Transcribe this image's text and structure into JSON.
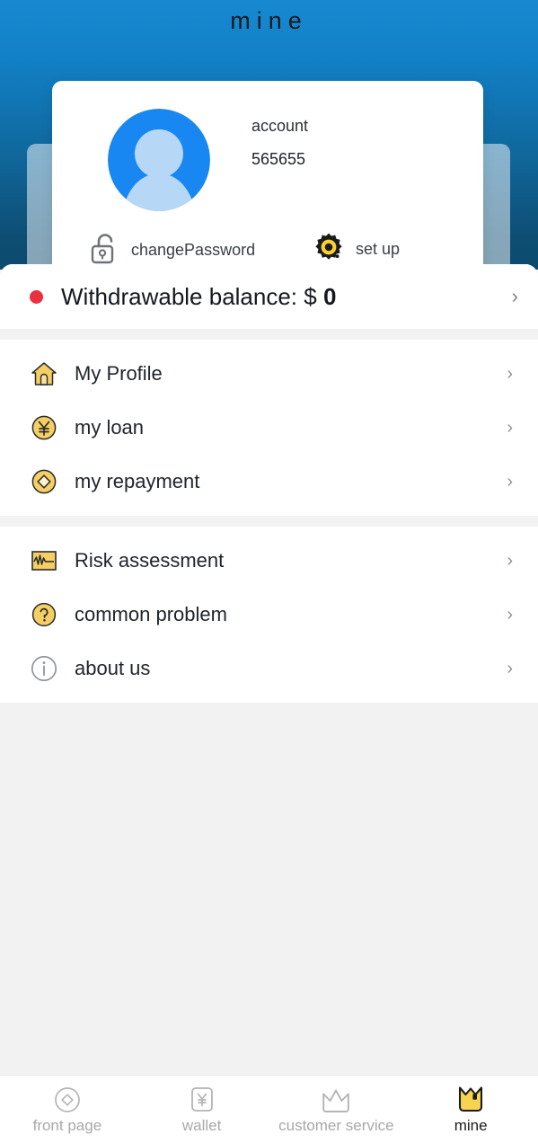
{
  "header": {
    "title": "mine"
  },
  "profile": {
    "avatar_icon": "user-avatar-icon",
    "account_label": "account",
    "account_value": "565655",
    "actions": [
      {
        "icon": "unlocked-padlock-icon",
        "label": "changePassword"
      },
      {
        "icon": "gear-icon",
        "label": "set up"
      }
    ]
  },
  "balance": {
    "dot_color": "#ea2f41",
    "prefix": "Withdrawable balance: $ ",
    "amount": "0",
    "chevron": "›"
  },
  "menu_groups": [
    {
      "items": [
        {
          "icon": "house-icon",
          "label": "My Profile",
          "chevron": "›"
        },
        {
          "icon": "yen-coin-icon",
          "label": "my loan",
          "chevron": "›"
        },
        {
          "icon": "coin-diamond-icon",
          "label": "my repayment",
          "chevron": "›"
        }
      ]
    },
    {
      "items": [
        {
          "icon": "chart-waveform-icon",
          "label": "Risk assessment",
          "chevron": "›"
        },
        {
          "icon": "question-circle-icon",
          "label": "common problem",
          "chevron": "›"
        },
        {
          "icon": "info-circle-icon",
          "label": "about us",
          "chevron": "›"
        }
      ]
    }
  ],
  "tabbar": {
    "items": [
      {
        "icon": "diamond-circle-icon",
        "label": "front page",
        "active": false
      },
      {
        "icon": "yen-square-icon",
        "label": "wallet",
        "active": false
      },
      {
        "icon": "crown-icon",
        "label": "customer service",
        "active": false
      },
      {
        "icon": "wallet-bag-icon",
        "label": "mine",
        "active": true
      }
    ]
  },
  "colors": {
    "header_gradient_top": "#1789d1",
    "header_gradient_bottom": "#0c4a6e",
    "accent_yellow": "#f5cf63",
    "avatar_blue": "#1887f2",
    "accent_red": "#ea2f41",
    "sheet_bg": "#f2f2f2"
  }
}
